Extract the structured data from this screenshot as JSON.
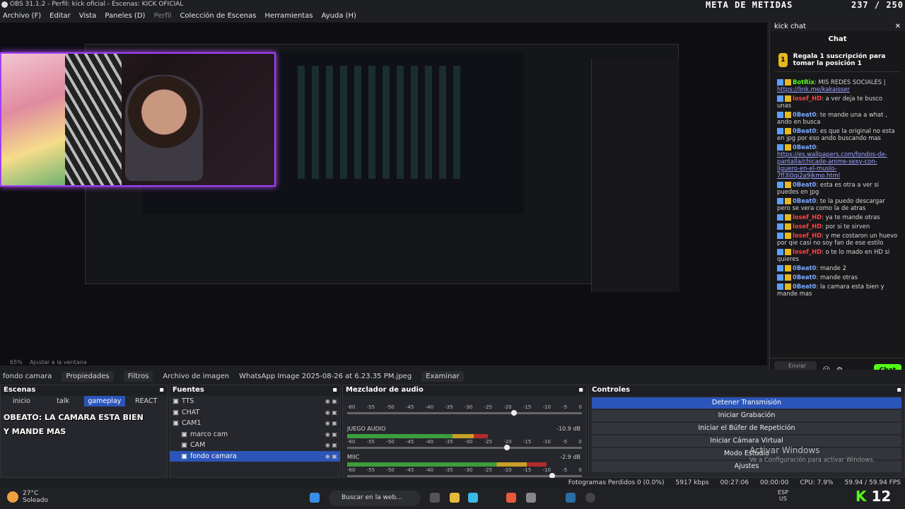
{
  "window": {
    "title": "OBS 31.1.2 - Perfil: kick oficial - Escenas: KICK OFICIAL"
  },
  "menu": [
    "Archivo (F)",
    "Editar",
    "Vista",
    "Paneles (D)",
    "Perfil",
    "Colección de Escenas",
    "Herramientas",
    "Ayuda (H)"
  ],
  "overlay": {
    "meta_label": "META DE METIDAS",
    "meta_count": "237 / 250"
  },
  "preview_bar": {
    "zoom": "65%",
    "fit": "Ajustar a la ventana"
  },
  "kick": {
    "panel_title": "kick chat",
    "chat_title": "Chat",
    "pinned": "Regala 1 suscripción para tomar la posición 1",
    "messages": [
      {
        "user": "BotRix",
        "text": ": MIS REDES SOCIALES |",
        "link": "https://link.me/kakaisser",
        "color": "#53fc18"
      },
      {
        "user": "losef_HD",
        "text": ": a ver deja te busco unas",
        "color": "#ff4040"
      },
      {
        "user": "0Beat0",
        "text": ": te mande una a what , ando en busca",
        "color": "#7aa8ff"
      },
      {
        "user": "0Beat0",
        "text": ": es que la original no esta en jpg por eso ando buscando mas",
        "color": "#7aa8ff"
      },
      {
        "user": "0Beat0",
        "text": ":",
        "link": "https://es.wallpapers.com/fondos-de-pantalla/chicade-anime-sexy-con-liguero-en-el-muslo-7fl3l0qi2a9jkmo.html",
        "color": "#7aa8ff"
      },
      {
        "user": "0Beat0",
        "text": ": esta es otra a ver si puedes en jpg",
        "color": "#7aa8ff"
      },
      {
        "user": "0Beat0",
        "text": ": te la puedo descargar pero se vera como la de atras",
        "color": "#7aa8ff"
      },
      {
        "user": "losef_HD",
        "text": ": ya te mande otras",
        "color": "#ff4040"
      },
      {
        "user": "losef_HD",
        "text": ": por si te sirven",
        "color": "#ff4040"
      },
      {
        "user": "losef_HD",
        "text": ": y me costaron un huevo por qie casi no soy fan de ese estilo",
        "color": "#ff4040"
      },
      {
        "user": "losef_HD",
        "text": ": o te lo mado en HD si quieres",
        "color": "#ff4040"
      },
      {
        "user": "0Beat0",
        "text": ": mande 2",
        "color": "#7aa8ff"
      },
      {
        "user": "0Beat0",
        "text": ": mande otras",
        "color": "#7aa8ff"
      },
      {
        "user": "0Beat0",
        "text": ": la camara esta bien y mande mas",
        "color": "#7aa8ff"
      }
    ],
    "input_placeholder": "Enviar un mensaje",
    "send": "Chat"
  },
  "source_bar": {
    "name": "fondo camara",
    "props": "Propiedades",
    "filters": "Filtros",
    "type": "Archivo de imagen",
    "file": "WhatsApp Image 2025-08-26 at 6.23.35 PM.jpeg",
    "browse": "Examinar"
  },
  "scenes": {
    "title": "Escenas",
    "items": [
      "inicio",
      "talk",
      "gameplay",
      "REACT"
    ],
    "overlay1": "OBEATO: LA CAMARA ESTA BIEN",
    "overlay2": "Y MANDE MAS"
  },
  "sources": {
    "title": "Fuentes",
    "items": [
      {
        "name": "TTS",
        "indent": 0
      },
      {
        "name": "CHAT",
        "indent": 0
      },
      {
        "name": "CAM1",
        "indent": 0
      },
      {
        "name": "marco cam",
        "indent": 1
      },
      {
        "name": "CAM",
        "indent": 1
      },
      {
        "name": "fondo camara",
        "indent": 1
      }
    ]
  },
  "mixer": {
    "title": "Mezclador de audio",
    "tracks": [
      {
        "name": "",
        "db": "",
        "level": 0.0,
        "fader": 0.7
      },
      {
        "name": "JUEGO AUDIO",
        "db": "-10.9 dB",
        "level": 0.6,
        "fader": 0.67
      },
      {
        "name": "MIIC",
        "db": "-2.9 dB",
        "level": 0.85,
        "fader": 0.86
      }
    ],
    "scale": [
      "-60",
      "-55",
      "-50",
      "-45",
      "-40",
      "-35",
      "-30",
      "-25",
      "-20",
      "-15",
      "-10",
      "-5",
      "0"
    ]
  },
  "controls": {
    "title": "Controles",
    "buttons": [
      "Detener Transmisión",
      "Iniciar Grabación",
      "Iniciar el Búfer de Repetición",
      "Iniciar Cámara Virtual",
      "Modo Estudio",
      "Ajustes"
    ]
  },
  "activate": {
    "title": "Activar Windows",
    "sub": "Ve a Configuración para activar Windows."
  },
  "status": {
    "dropped": "Fotogramas Perdidos 0 (0.0%)",
    "bitrate": "5917 kbps",
    "live": "00:27:06",
    "rec": "00:00:00",
    "cpu": "CPU: 7.9%",
    "fps": "59.94 / 59.94 FPS"
  },
  "taskbar": {
    "temp": "27°C",
    "weather": "Soleado",
    "search": "Buscar en la web...",
    "lang": "ESP",
    "region": "US",
    "k12": "12"
  }
}
